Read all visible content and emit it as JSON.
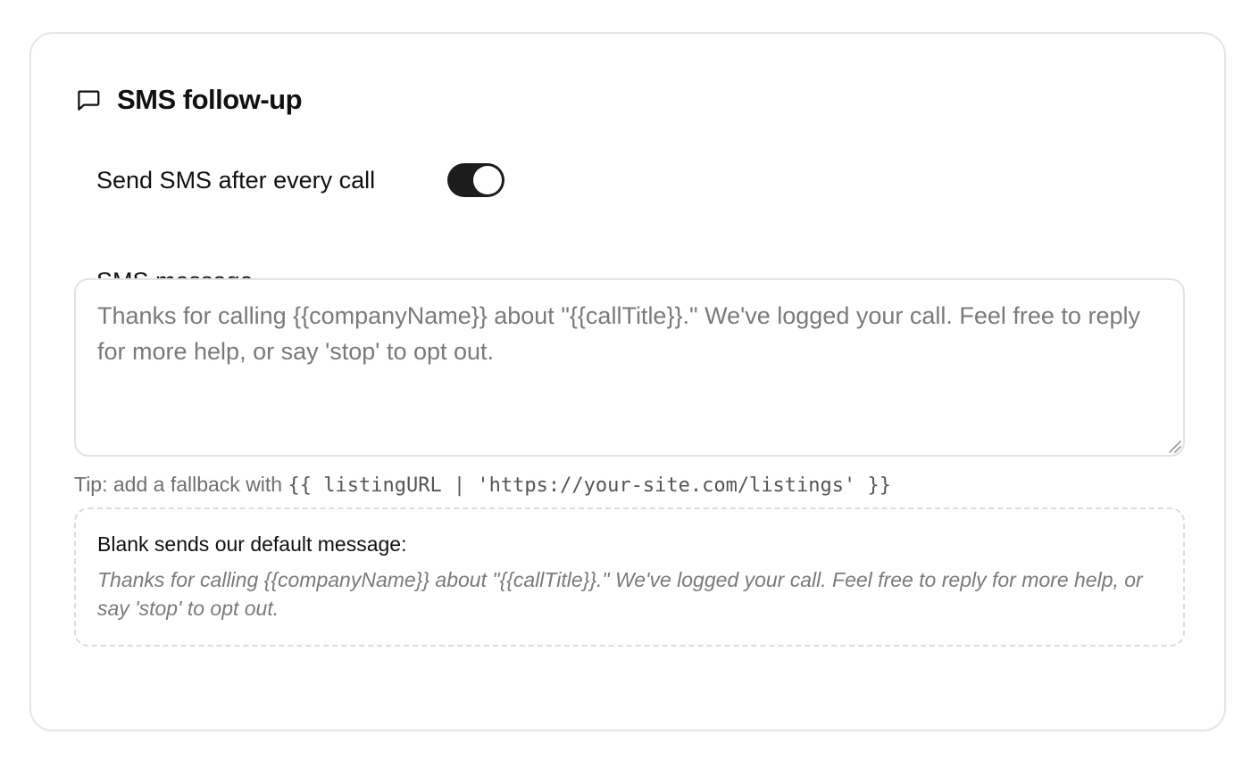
{
  "section": {
    "title": "SMS follow-up",
    "icon": "message-square-icon"
  },
  "toggle": {
    "label": "Send SMS after every call",
    "checked": true
  },
  "message": {
    "label": "SMS message",
    "value": "",
    "placeholder": "Thanks for calling {{companyName}} about \"{{callTitle}}.\" We've logged your call. Feel free to reply for more help, or say 'stop' to opt out."
  },
  "tip": {
    "prefix": "Tip: add a fallback with",
    "code": "{{ listingURL | 'https://your-site.com/listings' }}"
  },
  "default_message": {
    "heading": "Blank sends our default message:",
    "text": "Thanks for calling {{companyName}} about \"{{callTitle}}.\" We've logged your call. Feel free to reply for more help, or say 'stop' to opt out."
  },
  "colors": {
    "toggle_on": "#1c1c1c",
    "card_border": "#e6e6e6",
    "placeholder": "#7a7a7a"
  }
}
